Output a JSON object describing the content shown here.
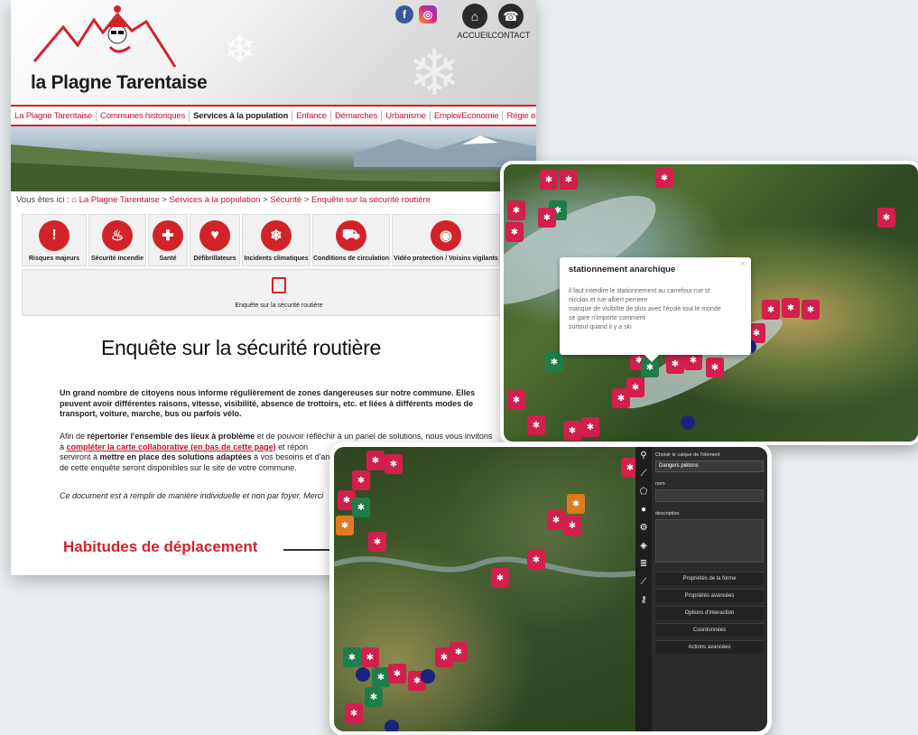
{
  "site": {
    "logo_text": "la Plagne Tarentaise",
    "social": {
      "facebook": "f",
      "instagram": "◎"
    },
    "top_links": [
      {
        "label": "ACCUEIL",
        "icon": "home-icon"
      },
      {
        "label": "CONTACT",
        "icon": "phone-icon"
      }
    ],
    "menu": [
      "La Plagne Tarentaise",
      "Communes historiques",
      "Services à la population",
      "Enfance",
      "Démarches",
      "Urbanisme",
      "Emploi/Economie",
      "Régie eau assainissement"
    ],
    "menu_active": "Services à la population",
    "breadcrumb": {
      "prefix": "Vous êtes ici :",
      "items": [
        "La Plagne Tarentaise",
        "Services à la population",
        "Sécurité",
        "Enquête sur la sécurité routière"
      ]
    },
    "service_icons": [
      {
        "label": "Risques majeurs",
        "icon": "warning-icon",
        "glyph": "!"
      },
      {
        "label": "Sécurité incendie",
        "icon": "fire-icon",
        "glyph": "♨"
      },
      {
        "label": "Santé",
        "icon": "medical-kit-icon",
        "glyph": "✚"
      },
      {
        "label": "Défibrillateurs",
        "icon": "heart-icon",
        "glyph": "♥"
      },
      {
        "label": "Incidents climatiques",
        "icon": "snowflake-icon",
        "glyph": "❄"
      },
      {
        "label": "Conditions de circulation",
        "icon": "car-icon",
        "glyph": "⛟"
      },
      {
        "label": "Vidéo protection / Voisins vigilants",
        "icon": "eye-icon",
        "glyph": "◉"
      }
    ],
    "survey_box_label": "Enquête sur la sécurité routière",
    "page_title": "Enquête sur la sécurité routière",
    "paragraph1": "Un grand nombre de citoyens nous informe régulièrement de zones dangereuses sur notre commune. Elles peuvent avoir différentes raisons, vitesse, visibilité, absence de trottoirs, etc. et liées à différents modes de transport, voiture, marche, bus ou parfois vélo.",
    "paragraph2_a": "Afin de ",
    "paragraph2_b": "répertorier l'ensemble des lieux à problème",
    "paragraph2_c": " et de pouvoir réfléchir à un panel de solutions, nous vous invitons à ",
    "paragraph2_link": "compléter la carte collaborative (en bas de cette page)",
    "paragraph2_d": " et répon",
    "paragraph2_e": "serviront à ",
    "paragraph2_f": "mettre en place des solutions adaptées",
    "paragraph2_g": " à vos besoins et d'ant",
    "paragraph2_h": "de cette enquête seront disponibles sur le site de votre commune.",
    "paragraph3": "Ce document est à remplir de manière individuelle et non par foyer. Merci",
    "subhead": "Habitudes de déplacement"
  },
  "map_popup": {
    "title": "stationnement anarchique",
    "close": "×",
    "lines": [
      "il faut interdire le stationnement au carrefour rue st",
      "nicolas et rue albert perriere",
      "manque de visibilite de plus avec l'école tout le monde",
      "se gare n'importe comment",
      "surtout quand il y a ski"
    ]
  },
  "editor_panel": {
    "layer_label": "Choisir le calque de l'élément",
    "layer_value": "Dangers piétons",
    "name_label": "nom",
    "description_label": "description",
    "buttons": [
      "Propriétés de la forme",
      "Propriétés avancées",
      "Options d'interaction",
      "Coordonnées",
      "Actions avancées"
    ],
    "tools": [
      "marker-icon",
      "polyline-icon",
      "polygon-icon",
      "circle-icon",
      "gear-icon",
      "layers-icon",
      "database-icon",
      "ruler-icon",
      "key-icon"
    ]
  },
  "colors": {
    "brand_red": "#d2232a",
    "pin_red": "#d21f4b",
    "pin_green": "#1f7d4a",
    "pin_blue": "#1a237e",
    "panel_dark": "#2b2b2b"
  }
}
